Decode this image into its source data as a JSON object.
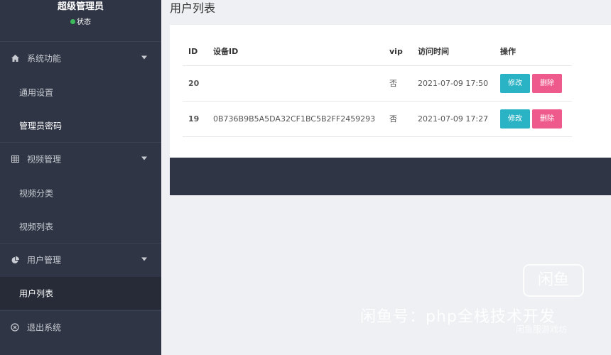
{
  "sidebar": {
    "admin_name": "超级管理员",
    "status_label": "状态",
    "status_color": "#3dbb5c",
    "groups": [
      {
        "label": "系统功能",
        "icon": "home-icon"
      },
      {
        "label": "视频管理",
        "icon": "grid-icon"
      },
      {
        "label": "用户管理",
        "icon": "pie-chart-icon"
      }
    ],
    "items": {
      "general_settings": "通用设置",
      "admin_password": "管理员密码",
      "video_category": "视频分类",
      "video_list": "视频列表",
      "user_list": "用户列表"
    },
    "logout": {
      "label": "退出系统",
      "icon": "logout-icon"
    }
  },
  "main": {
    "title": "用户列表",
    "table": {
      "headers": [
        "ID",
        "设备ID",
        "vip",
        "访问时间",
        "操作"
      ],
      "rows": [
        {
          "id": "20",
          "device_id": "",
          "vip": "否",
          "time": "2021-07-09 17:50",
          "edit": "修改",
          "delete": "删除"
        },
        {
          "id": "19",
          "device_id": "0B736B9B5A5DA32CF1BC5B2FF2459293",
          "vip": "否",
          "time": "2021-07-09 17:27",
          "edit": "修改",
          "delete": "删除"
        }
      ]
    }
  },
  "colors": {
    "sidebar_bg": "#2f3544",
    "edit_button": "#2ab3c4",
    "delete_button": "#ef5a8c",
    "page_bg": "#eef0f3"
  },
  "watermark": {
    "logo": "闲鱼",
    "line1": "闲鱼号：php全栈技术开发",
    "line2": "闲鱼服游戏坊"
  }
}
